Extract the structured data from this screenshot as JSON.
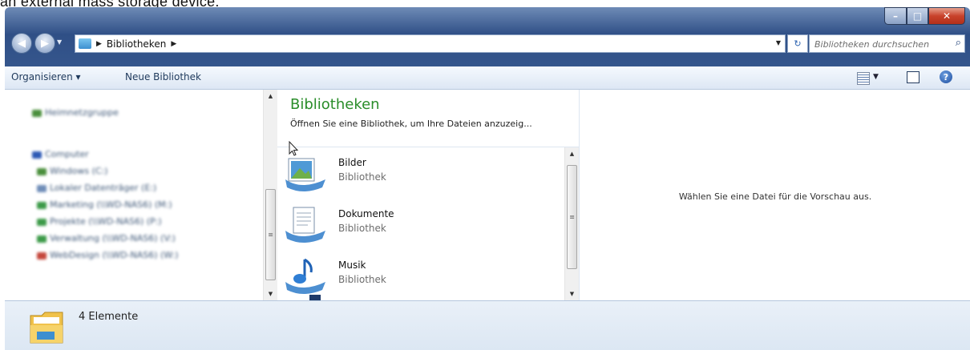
{
  "background_caption": "an external mass storage device.",
  "window": {
    "caption_buttons": [
      "–",
      "□",
      "✕"
    ]
  },
  "address_bar": {
    "crumb": "Bibliotheken",
    "search_placeholder": "Bibliotheken durchsuchen"
  },
  "toolbar": {
    "organize_label": "Organisieren ▾",
    "new_library_label": "Neue Bibliothek"
  },
  "nav_pane": {
    "items": [
      {
        "label": "Heimnetzgruppe",
        "color": "#4a8f3c"
      },
      {
        "label": "Computer",
        "color": "#2d59b5"
      },
      {
        "label": "Windows (C:)",
        "color": "#4a8f3c"
      },
      {
        "label": "Lokaler Datenträger (E:)",
        "color": "#6f8db8"
      },
      {
        "label": "Marketing (\\\\WD-NAS6) (M:)",
        "color": "#3c9a48"
      },
      {
        "label": "Projekte (\\\\WD-NAS6) (P:)",
        "color": "#3c9a48"
      },
      {
        "label": "Verwaltung (\\\\WD-NAS6) (V:)",
        "color": "#3c9a48"
      },
      {
        "label": "WebDesign (\\\\WD-NAS6) (W:)",
        "color": "#c5473c"
      }
    ]
  },
  "library_pane": {
    "title": "Bibliotheken",
    "subtitle": "Öffnen Sie eine Bibliothek, um Ihre Dateien anzuzeig...",
    "items": [
      {
        "name": "Bilder",
        "type": "Bibliothek",
        "icon": "pictures-library-icon"
      },
      {
        "name": "Dokumente",
        "type": "Bibliothek",
        "icon": "documents-library-icon"
      },
      {
        "name": "Musik",
        "type": "Bibliothek",
        "icon": "music-library-icon"
      }
    ]
  },
  "preview_pane": {
    "message": "Wählen Sie eine Datei für die Vorschau aus."
  },
  "status_bar": {
    "count_text": "4 Elemente"
  }
}
